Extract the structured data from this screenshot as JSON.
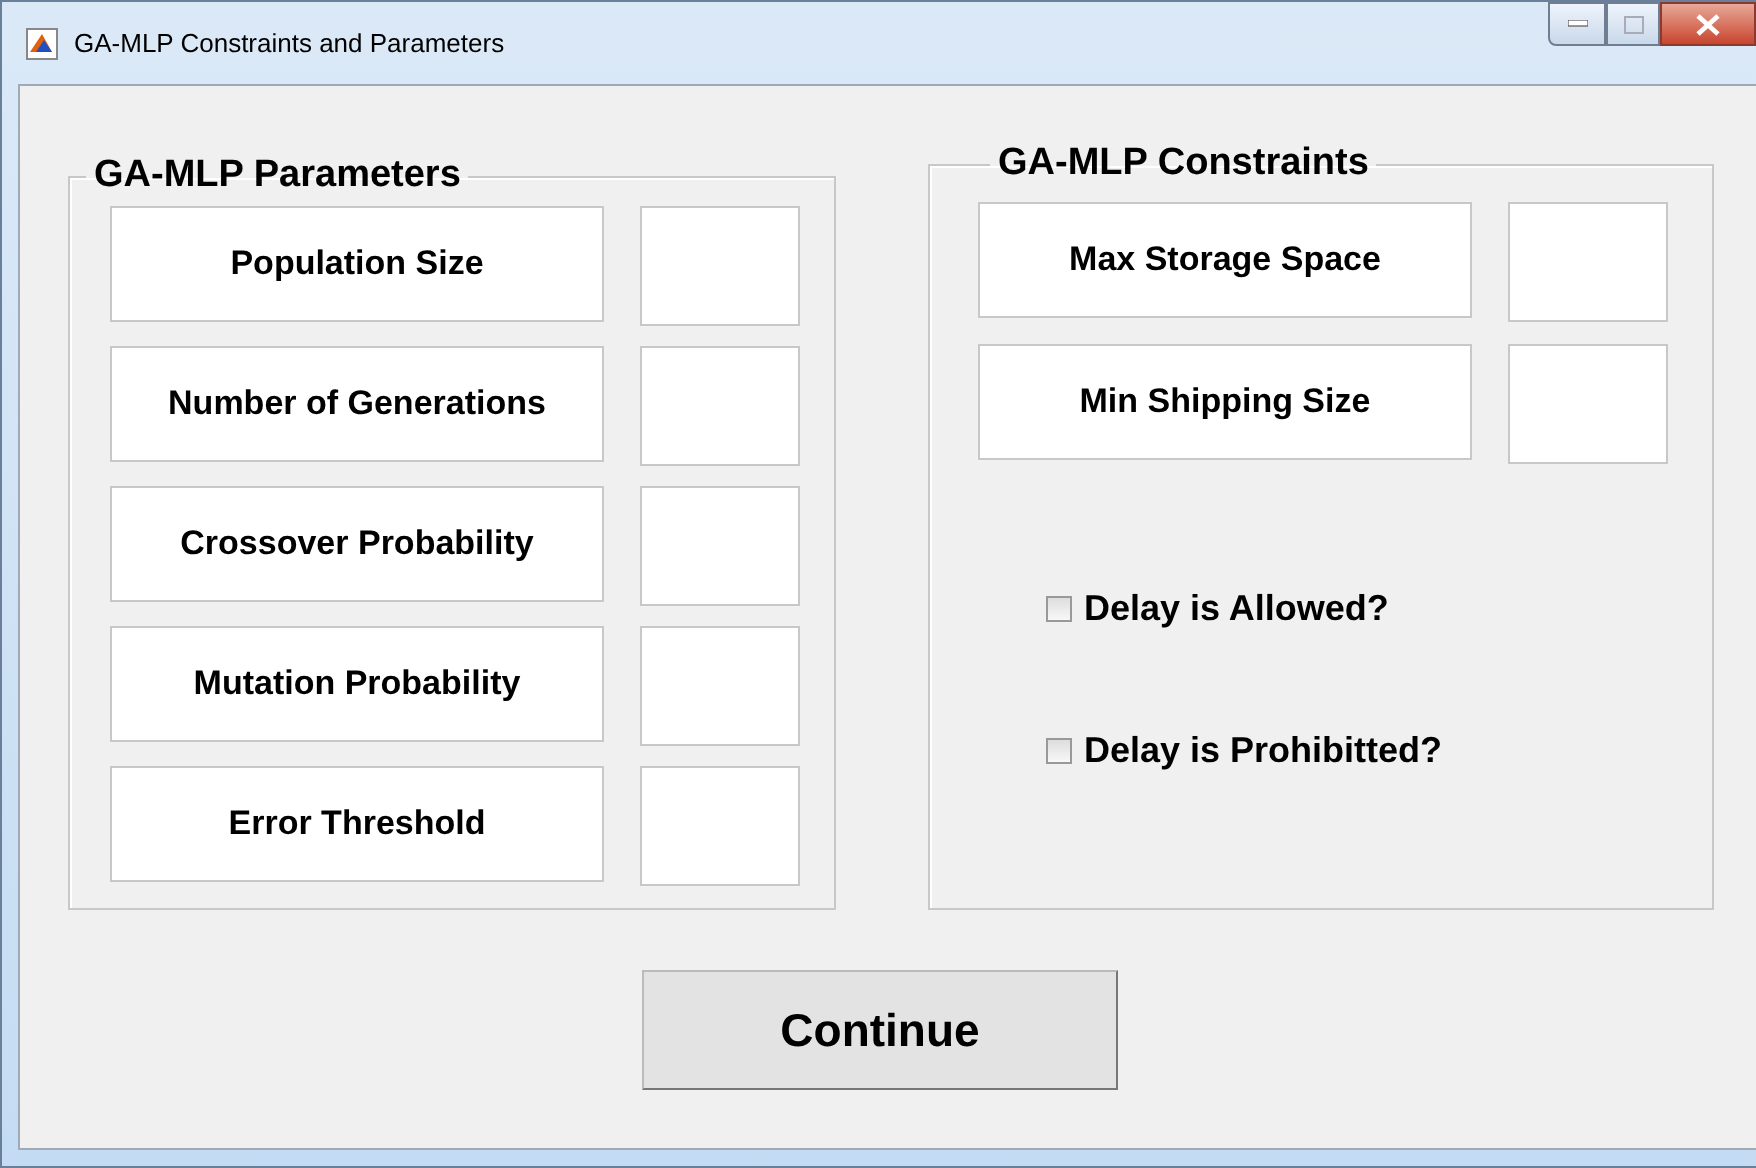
{
  "window": {
    "title": "GA-MLP Constraints and Parameters"
  },
  "parameters": {
    "title": "GA-MLP Parameters",
    "rows": [
      {
        "label": "Population Size"
      },
      {
        "label": "Number of Generations"
      },
      {
        "label": "Crossover Probability"
      },
      {
        "label": "Mutation Probability"
      },
      {
        "label": "Error Threshold"
      }
    ]
  },
  "constraints": {
    "title": "GA-MLP Constraints",
    "rows": [
      {
        "label": "Max Storage Space"
      },
      {
        "label": "Min Shipping Size"
      }
    ],
    "checkboxes": [
      {
        "label": "Delay is Allowed?",
        "checked": false
      },
      {
        "label": "Delay is Prohibitted?",
        "checked": false
      }
    ]
  },
  "buttons": [
    "Continue"
  ]
}
